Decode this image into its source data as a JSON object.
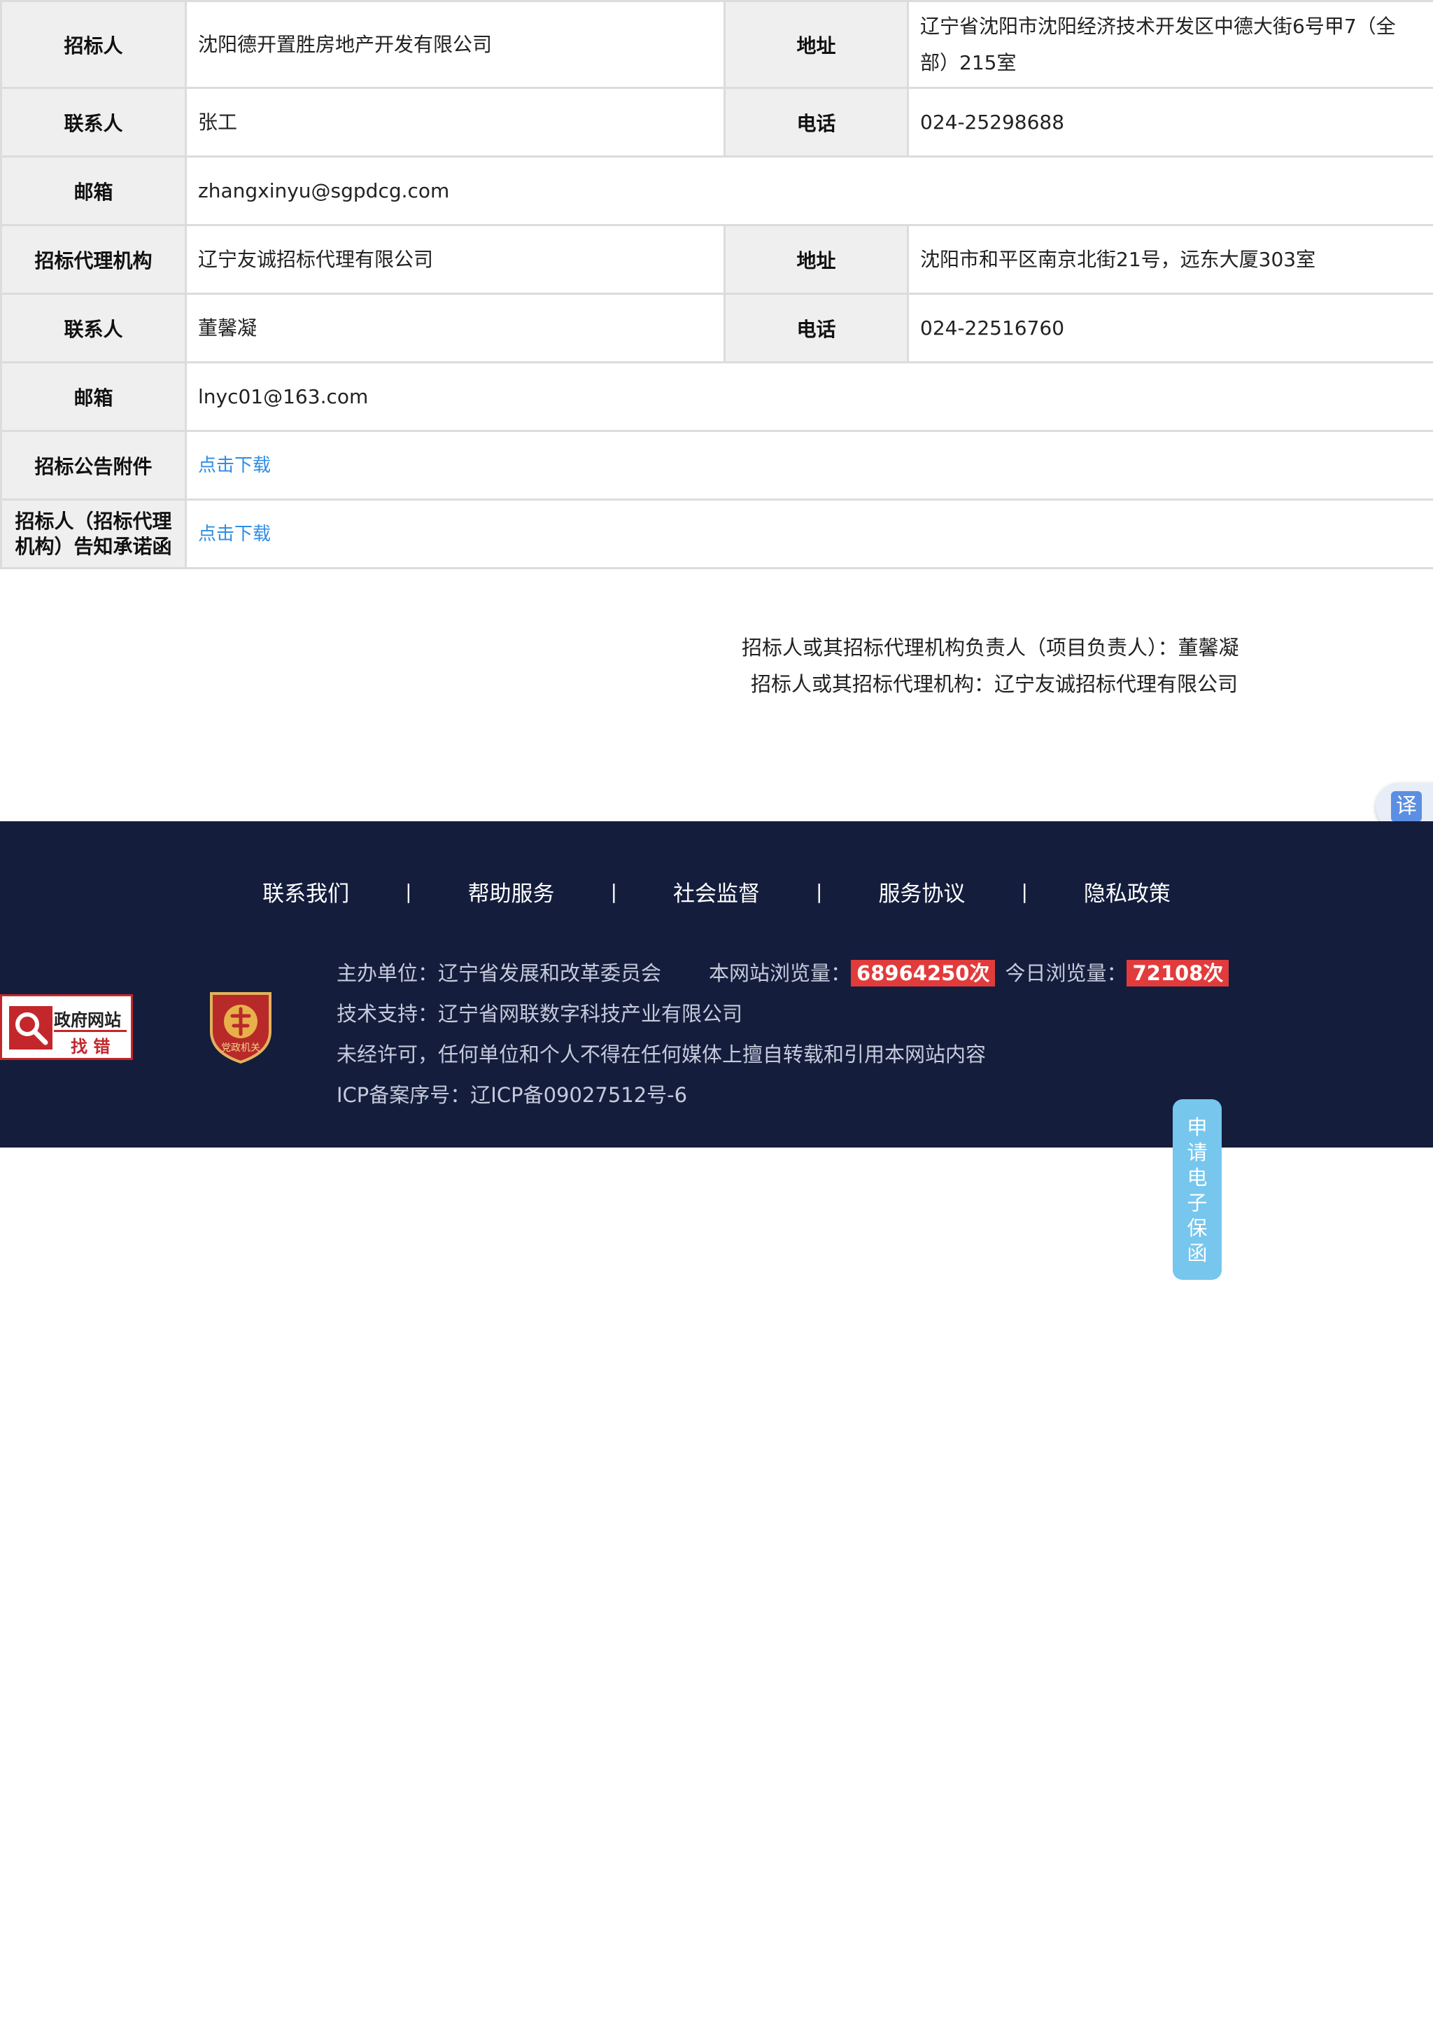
{
  "table": {
    "rows": [
      {
        "label1": "招标人",
        "value1": "沈阳德开置胜房地产开发有限公司",
        "label2": "地址",
        "value2": "辽宁省沈阳市沈阳经济技术开发区中德大街6号甲7（全部）215室"
      },
      {
        "label1": "联系人",
        "value1": "张工",
        "label2": "电话",
        "value2": "024-25298688"
      },
      {
        "label1": "邮箱",
        "value1": "zhangxinyu@sgpdcg.com"
      },
      {
        "label1": "招标代理机构",
        "value1": "辽宁友诚招标代理有限公司",
        "label2": "地址",
        "value2": "沈阳市和平区南京北街21号，远东大厦303室"
      },
      {
        "label1": "联系人",
        "value1": "董馨凝",
        "label2": "电话",
        "value2": "024-22516760"
      },
      {
        "label1": "邮箱",
        "value1": "lnyc01@163.com"
      },
      {
        "label1": "招标公告附件",
        "link": "点击下载"
      },
      {
        "label1": "招标人（招标代理机构）告知承诺函",
        "link": "点击下载"
      }
    ]
  },
  "signature": {
    "line1": "招标人或其招标代理机构负责人（项目负责人）：董馨凝",
    "line2": "招标人或其招标代理机构：辽宁友诚招标代理有限公司"
  },
  "translate": {
    "label": "译"
  },
  "footer": {
    "nav": [
      "联系我们",
      "帮助服务",
      "社会监督",
      "服务协议",
      "隐私政策"
    ],
    "separator": "|",
    "host": "主办单位：辽宁省发展和改革委员会",
    "visits_label": "本网站浏览量：",
    "visits_count": "68964250次",
    "today_label": "今日浏览量：",
    "today_count": "72108次",
    "tech": "技术支持：辽宁省网联数字科技产业有限公司",
    "copyright": "未经许可，任何单位和个人不得在任何媒体上擅自转载和引用本网站内容",
    "icp": "ICP备案序号：辽ICP备09027512号-6",
    "gov_badge_line1": "政府网站",
    "gov_badge_line2": "找 错",
    "party_badge_text": "党政机关"
  },
  "side_pill": {
    "chars": [
      "申",
      "请",
      "电",
      "子",
      "保",
      "函"
    ]
  },
  "colors": {
    "footer_bg": "#141d3c",
    "badge_red": "#e23b3b",
    "link_blue": "#2f8de4",
    "pill_blue": "#76c6ee"
  }
}
